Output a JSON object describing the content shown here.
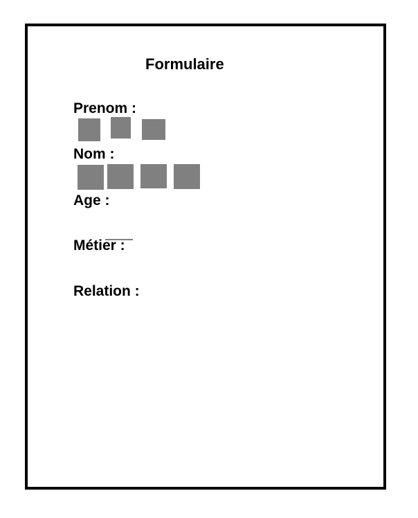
{
  "form": {
    "title": "Formulaire",
    "prenom_label": "Prenom :",
    "nom_label": "Nom :",
    "age_label": "Age :",
    "metier_label": "Métier :",
    "relation_label": "Relation :",
    "redacted_color": "#808080"
  }
}
